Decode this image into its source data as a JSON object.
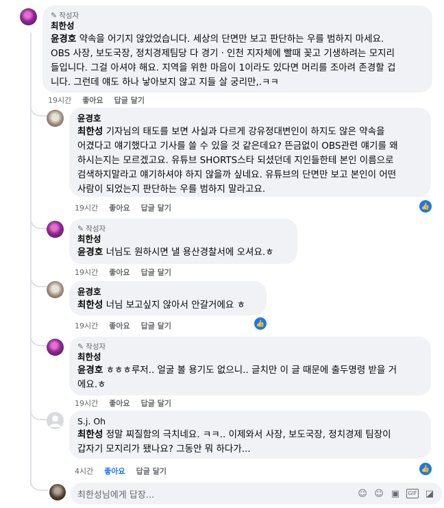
{
  "comment_main": {
    "badge": "작성자",
    "author": "최한성",
    "mention": "윤경호",
    "lines": [
      "약속을 어기지 않았었습니다. 세상의 단면만 보고 판단하는 우를 범하지 마세요.",
      "OBS 사장, 보도국장, 정치경제팀당 다 경기ㆍ인천 지자체에 빨때 꽂고 기생하려는 모지리",
      "들입니다. 그걸 아셔야 해요. 지역을 위한 마음이 1이라도 있다면 머리를 조아려 존경할 겁",
      "니다. 그런데 얘도 하나 낳아보지 않고 지들 살 궁리만,.ㅋㅋ"
    ],
    "time": "19시간",
    "like": "좋아요",
    "reply": "답글 달기"
  },
  "reply_1": {
    "author": "윤경호",
    "mention": "최한성",
    "lines": [
      "기자님의 태도를 보면 사실과 다르게 강유정대변인이 하지도 않은 약속을",
      "어겼다고 얘기했다고 기사를 쓸 수 있을 것 같은데요? 뜬금없이 OBS관련 얘기를 왜",
      "하시는지는 모르겠고요. 유튜브 SHORTS스타 되셨던데 지인들한테 본인 이름으로",
      "검색하지말라고 얘기하셔야 하지 않을까 싶네요. 유튜브의 단면만 보고 본인이 어떤",
      "사람이 되었는지 판단하는 우를 범하지 말라고요."
    ],
    "time": "19시간",
    "like": "좋아요",
    "reply": "답글 달기"
  },
  "reply_2": {
    "badge": "작성자",
    "author": "최한성",
    "mention": "윤경호",
    "text": "너님도 원하시면 낼 용산경찰서에 오셔요.ㅎ",
    "time": "19시간",
    "like": "좋아요",
    "reply": "답글 달기"
  },
  "reply_3": {
    "author": "윤경호",
    "mention": "최한성",
    "text": "너님 보고싶지 않아서 안갈거에요 ㅎ",
    "time": "19시간",
    "like": "좋아요",
    "reply": "답글 달기"
  },
  "reply_4": {
    "badge": "작성자",
    "author": "최한성",
    "mention": "윤경호",
    "lines": [
      "ㅎㅎㅎ루저.. 얼굴 볼 용기도 없으니.. 글치만 이 글 때문에 출두명령 받을 거",
      "에요.ㅎ"
    ],
    "time": "19시간",
    "like": "좋아요",
    "reply": "답글 달기"
  },
  "reply_5": {
    "author": "S.j. Oh",
    "mention": "최한성",
    "lines": [
      "정말 찌질함의 극치네요. ㅋㅋ.. 이제와서 사장, 보도국장, 정치경제 팀장이",
      "갑자기 모지리가 됐나요? 그동안 뭐 하다가..."
    ],
    "time": "4시간",
    "like": "좋아요",
    "reply": "답글 달기"
  },
  "reply_input": {
    "placeholder": "최한성님에게 답장..."
  },
  "colors": {
    "like_blue": "#1877f2",
    "bubble_bg": "#f0f2f5",
    "meta_grey": "#65676b"
  }
}
